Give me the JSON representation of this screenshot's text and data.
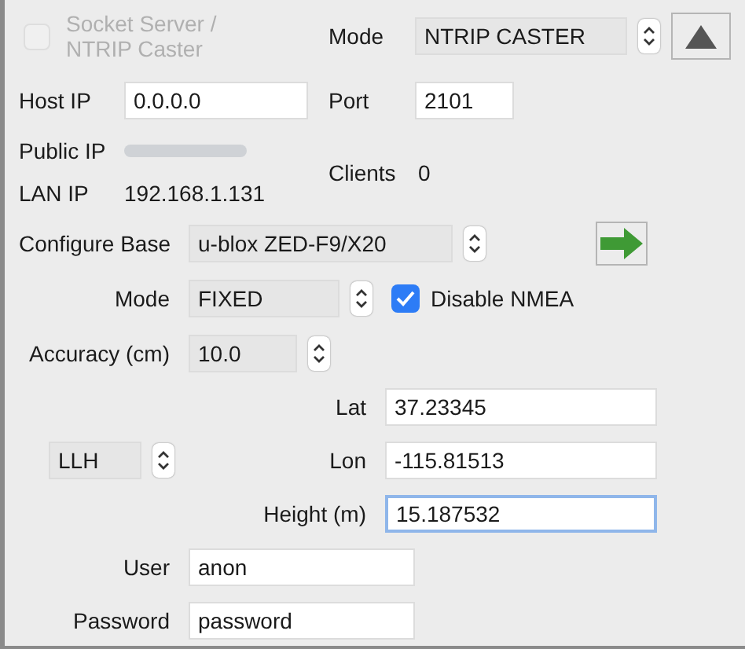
{
  "server": {
    "enable": {
      "label": "Socket Server / NTRIP Caster",
      "checked": false,
      "disabled": true
    },
    "mode": {
      "label": "Mode",
      "value": "NTRIP CASTER"
    },
    "host_ip": {
      "label": "Host IP",
      "value": "0.0.0.0"
    },
    "port": {
      "label": "Port",
      "value": "2101"
    },
    "public_ip": {
      "label": "Public IP",
      "redacted": true
    },
    "lan_ip": {
      "label": "LAN IP",
      "value": "192.168.1.131"
    },
    "clients": {
      "label": "Clients",
      "value": "0"
    }
  },
  "base": {
    "receiver": {
      "label": "Configure Base",
      "value": "u-blox ZED-F9/X20"
    },
    "mode": {
      "label": "Mode",
      "value": "FIXED"
    },
    "disable_nmea": {
      "label": "Disable NMEA",
      "checked": true
    },
    "accuracy": {
      "label": "Accuracy (cm)",
      "value": "10.0"
    },
    "coord_system": {
      "value": "LLH"
    },
    "coordinates": [
      {
        "label": "Lat",
        "value": "37.23345",
        "focused": false
      },
      {
        "label": "Lon",
        "value": "-115.81513",
        "focused": false
      },
      {
        "label": "Height (m)",
        "value": "15.187532",
        "focused": true
      }
    ],
    "user": {
      "label": "User",
      "value": "anon"
    },
    "password": {
      "label": "Password",
      "value": "password"
    }
  }
}
